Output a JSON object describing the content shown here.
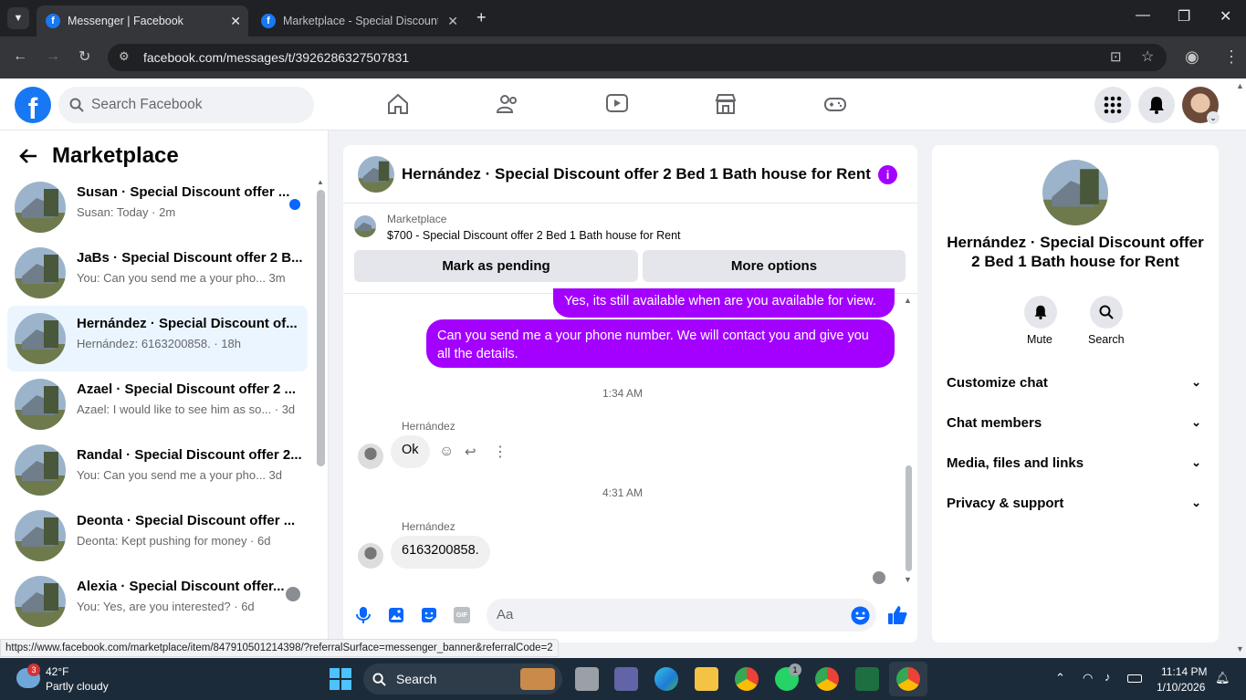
{
  "browser": {
    "tabs": [
      {
        "title": "Messenger | Facebook",
        "active": true
      },
      {
        "title": "Marketplace - Special Discount",
        "active": false
      }
    ],
    "url": "facebook.com/messages/t/3926286327507831",
    "status_url": "https://www.facebook.com/marketplace/item/847910501214398/?referralSurface=messenger_banner&referralCode=2"
  },
  "header": {
    "search_placeholder": "Search Facebook",
    "accent": "#1877f2"
  },
  "left": {
    "title": "Marketplace",
    "conversations": [
      {
        "name": "Susan · Special Discount offer ...",
        "snippet": "Susan: Today · 2m",
        "unread": true
      },
      {
        "name": "JaBs · Special Discount offer 2 B...",
        "snippet": "You: Can you send me a your pho...  3m"
      },
      {
        "name": "Hernández · Special Discount of...",
        "snippet": "Hernández: 6163200858. · 18h",
        "selected": true
      },
      {
        "name": "Azael · Special Discount offer 2 ...",
        "snippet": "Azael: I would like to see him as so... · 3d"
      },
      {
        "name": "Randal · Special Discount offer 2...",
        "snippet": "You: Can you send me a your pho...  3d"
      },
      {
        "name": "Deonta · Special Discount offer ...",
        "snippet": "Deonta: Kept pushing for money · 6d"
      },
      {
        "name": "Alexia · Special Discount offer...",
        "snippet": "You: Yes, are you interested? · 6d"
      }
    ]
  },
  "chat": {
    "title": "Hernández · Special Discount offer 2 Bed 1 Bath house for Rent",
    "banner_label": "Marketplace",
    "banner_item": "$700 - Special Discount offer 2 Bed 1 Bath house for Rent",
    "mark_pending": "Mark as pending",
    "more_options": "More options",
    "messages": {
      "out1": "Yes, its still available when are you available for view.",
      "out2": "Can you send me a your phone number. We will contact you and give you all the details.",
      "time1": "1:34 AM",
      "sender1": "Hernández",
      "in1": "Ok",
      "time2": "4:31 AM",
      "sender2": "Hernández",
      "in2": "6163200858."
    },
    "input_placeholder": "Aa",
    "gif_label": "GIF",
    "bubble_color": "#a400ff"
  },
  "right": {
    "title": "Hernández · Special Discount offer 2 Bed 1 Bath house for Rent",
    "mute": "Mute",
    "search": "Search",
    "sections": [
      "Customize chat",
      "Chat members",
      "Media, files and links",
      "Privacy & support"
    ]
  },
  "taskbar": {
    "temp": "42°F",
    "weather": "Partly cloudy",
    "weather_badge": "3",
    "search": "Search",
    "whatsapp_badge": "1",
    "time": "11:14 PM",
    "date": "1/10/2026"
  }
}
